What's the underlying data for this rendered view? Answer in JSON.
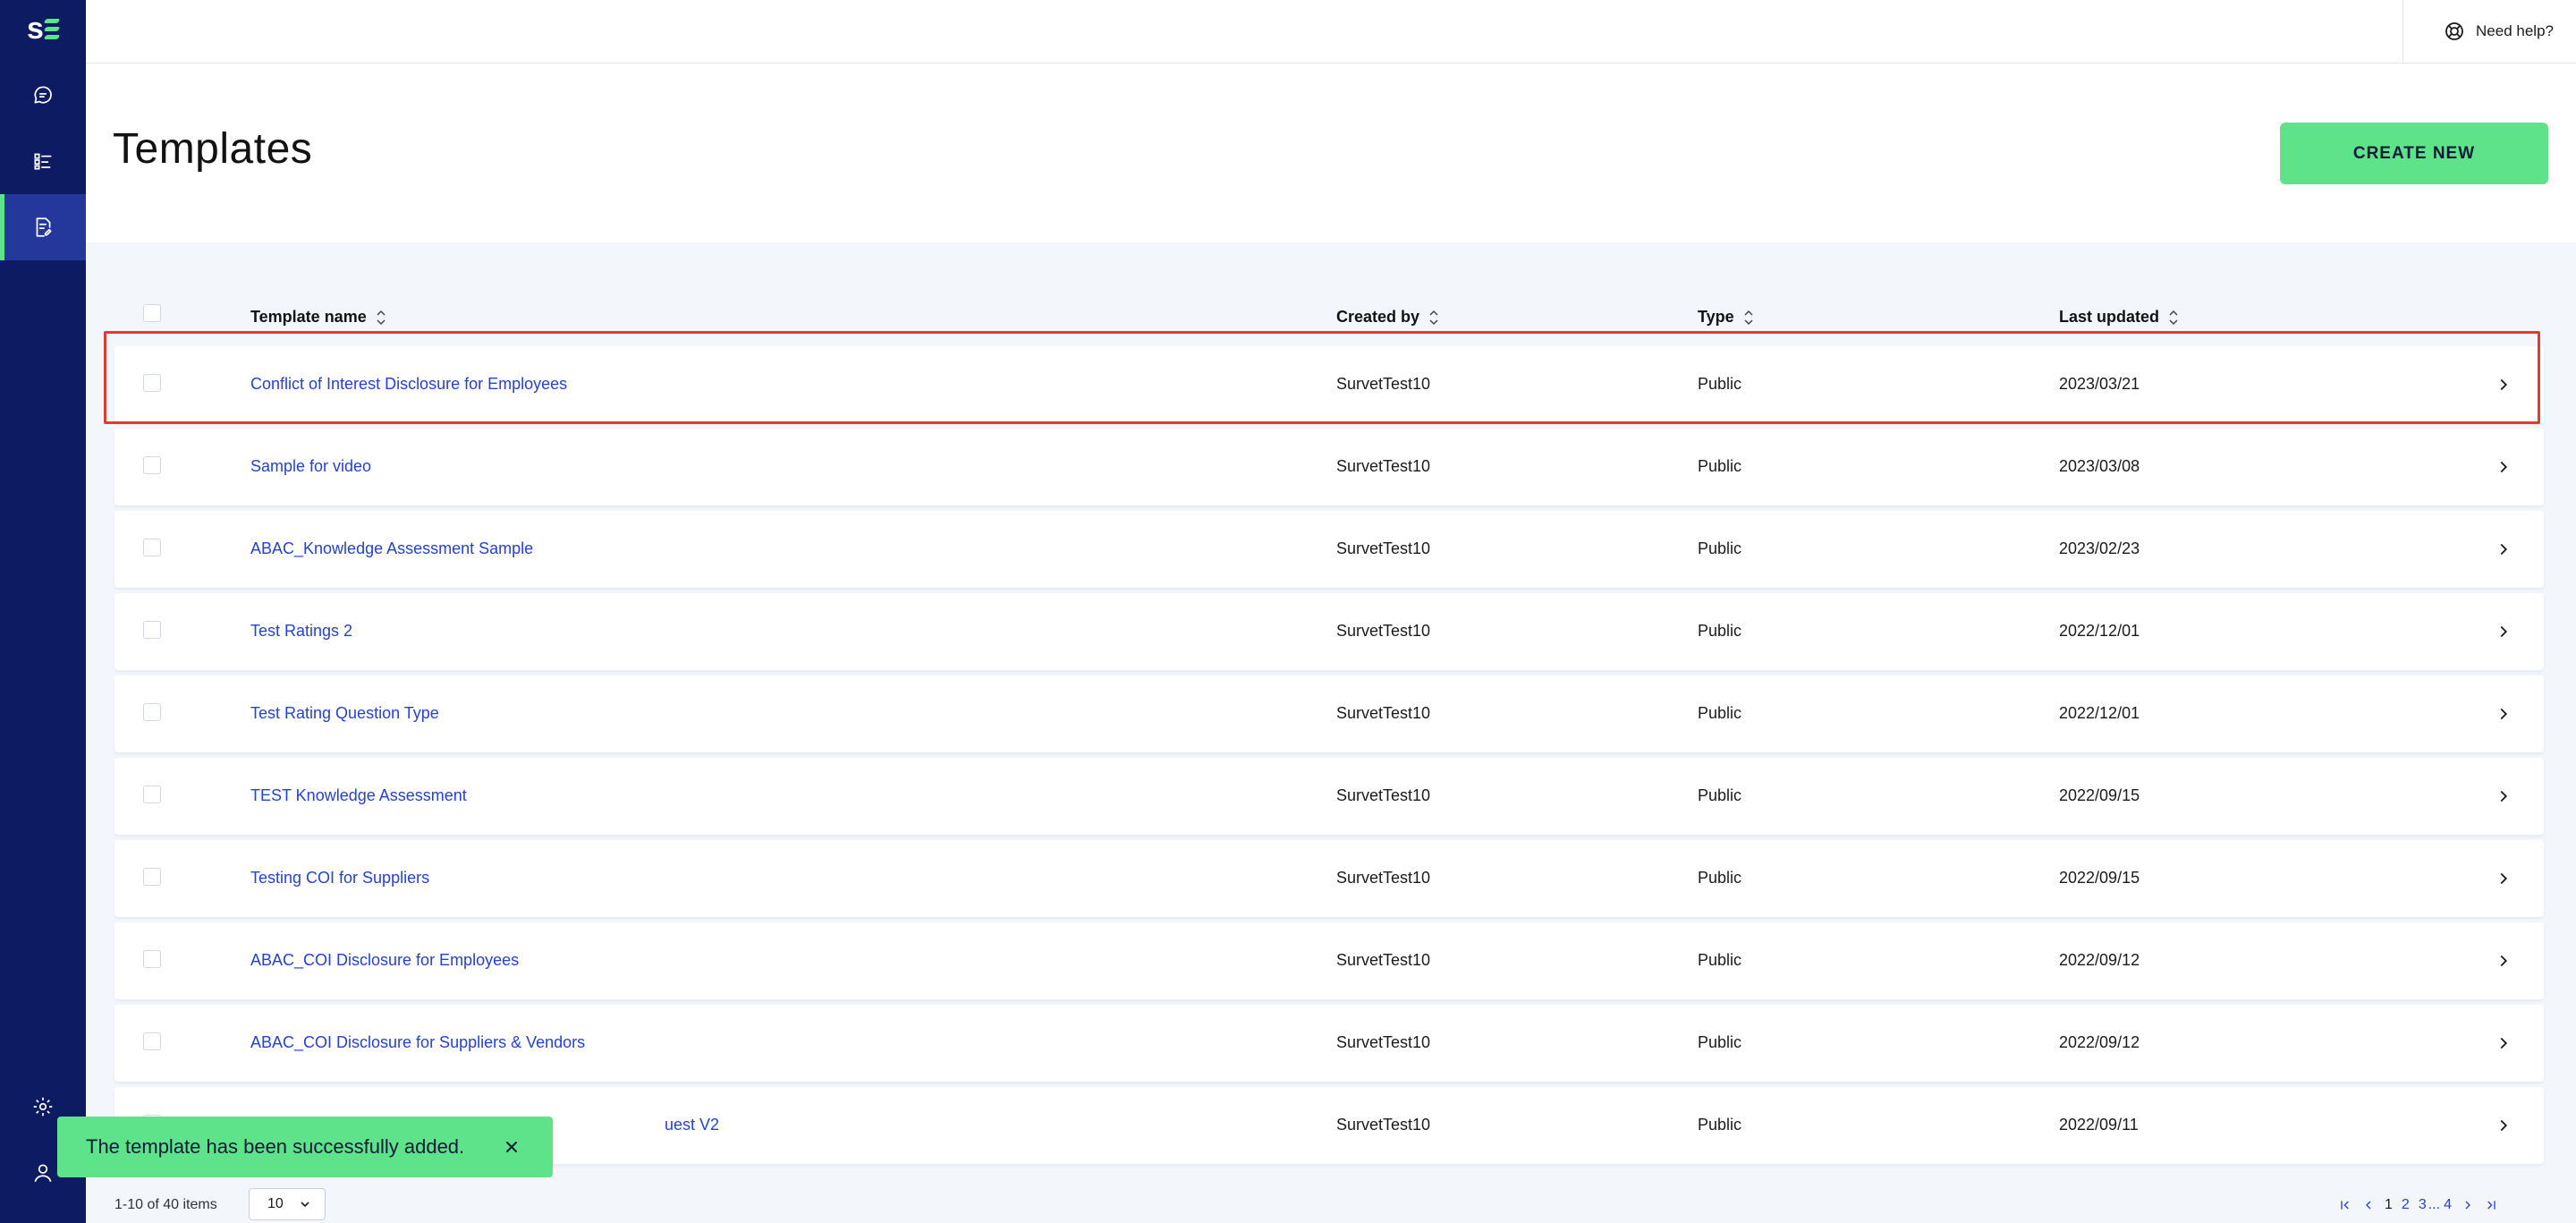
{
  "sidebar": {
    "logo_text": "s",
    "items": [
      {
        "icon": "chat-bubble-icon",
        "active": false
      },
      {
        "icon": "checklist-icon",
        "active": false
      },
      {
        "icon": "document-edit-icon",
        "active": true
      }
    ],
    "bottom_items": [
      {
        "icon": "gear-icon"
      },
      {
        "icon": "user-icon"
      }
    ],
    "accent": "#5ee38a",
    "background": "#0d1b63"
  },
  "topbar": {
    "help_label": "Need help?",
    "help_icon": "lifebuoy-icon",
    "power_icon": "power-icon"
  },
  "page": {
    "title": "Templates",
    "create_label": "CREATE NEW"
  },
  "table": {
    "columns": [
      "Template name",
      "Created by",
      "Type",
      "Last updated"
    ],
    "rows": [
      {
        "name": "Conflict of Interest Disclosure for Employees",
        "created_by": "SurvetTest10",
        "type": "Public",
        "updated": "2023/03/21"
      },
      {
        "name": "Sample for video",
        "created_by": "SurvetTest10",
        "type": "Public",
        "updated": "2023/03/08"
      },
      {
        "name": "ABAC_Knowledge Assessment Sample",
        "created_by": "SurvetTest10",
        "type": "Public",
        "updated": "2023/02/23"
      },
      {
        "name": "Test Ratings 2",
        "created_by": "SurvetTest10",
        "type": "Public",
        "updated": "2022/12/01"
      },
      {
        "name": "Test Rating Question Type",
        "created_by": "SurvetTest10",
        "type": "Public",
        "updated": "2022/12/01"
      },
      {
        "name": "TEST Knowledge Assessment",
        "created_by": "SurvetTest10",
        "type": "Public",
        "updated": "2022/09/15"
      },
      {
        "name": "Testing COI for Suppliers",
        "created_by": "SurvetTest10",
        "type": "Public",
        "updated": "2022/09/15"
      },
      {
        "name": "ABAC_COI Disclosure for Employees",
        "created_by": "SurvetTest10",
        "type": "Public",
        "updated": "2022/09/12"
      },
      {
        "name": "ABAC_COI Disclosure for Suppliers & Vendors",
        "created_by": "SurvetTest10",
        "type": "Public",
        "updated": "2022/09/12"
      },
      {
        "name": "uest V2",
        "created_by": "SurvetTest10",
        "type": "Public",
        "updated": "2022/09/11"
      }
    ]
  },
  "footer": {
    "items_count": "1-10 of 40 items",
    "page_size": "10",
    "pages": [
      "1",
      "2",
      "3",
      "...",
      "4"
    ]
  },
  "toast": {
    "message": "The template has been successfully added."
  }
}
